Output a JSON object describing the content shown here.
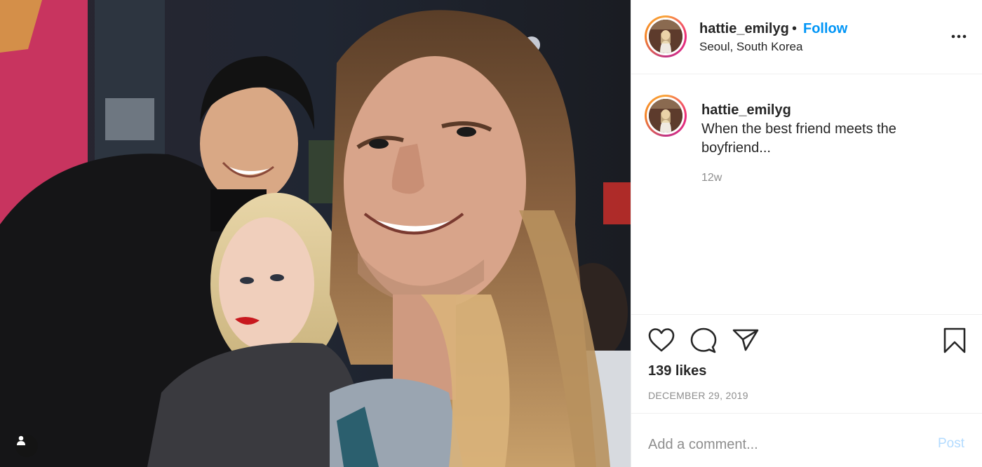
{
  "post": {
    "username": "hattie_emilyg",
    "separator": "•",
    "follow_label": "Follow",
    "location": "Seoul, South Korea",
    "caption": "When the best friend meets the boyfriend...",
    "time_ago": "12w",
    "likes": "139 likes",
    "date": "DECEMBER 29, 2019"
  },
  "comment": {
    "placeholder": "Add a comment...",
    "post_label": "Post"
  },
  "icons": {
    "like": "heart-icon",
    "comment": "comment-icon",
    "share": "share-icon",
    "save": "bookmark-icon",
    "more": "more-icon",
    "tag": "user-tag-icon"
  },
  "colors": {
    "link": "#0095f6",
    "post_disabled": "#b3dbff",
    "secondary_text": "#8e8e8e",
    "border": "#efefef"
  }
}
